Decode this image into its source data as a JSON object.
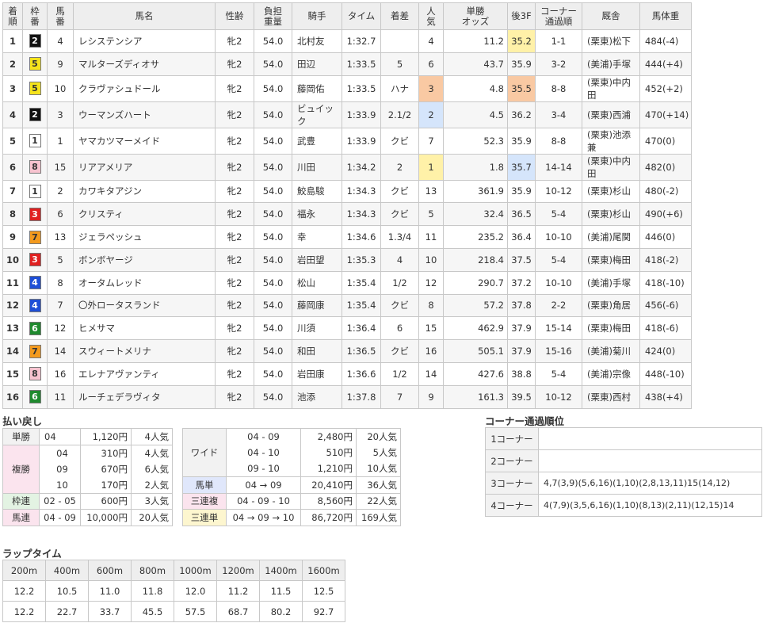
{
  "results": {
    "headers": [
      "着\n順",
      "枠\n番",
      "馬\n番",
      "馬名",
      "性齢",
      "負担\n重量",
      "騎手",
      "タイム",
      "着差",
      "人\n気",
      "単勝\nオッズ",
      "後3F",
      "コーナー\n通過順",
      "厩舎",
      "馬体重"
    ],
    "rows": [
      {
        "rank": "1",
        "waku": "2",
        "umaban": "4",
        "name": "レシステンシア",
        "sex_age": "牝2",
        "weight": "54.0",
        "jockey": "北村友",
        "time": "1:32.7",
        "margin": "",
        "pop": "4",
        "odds": "11.2",
        "last3f": "35.2",
        "corner": "1-1",
        "stable": "(栗東)松下",
        "bw": "484(-4)"
      },
      {
        "rank": "2",
        "waku": "5",
        "umaban": "9",
        "name": "マルターズディオサ",
        "sex_age": "牝2",
        "weight": "54.0",
        "jockey": "田辺",
        "time": "1:33.5",
        "margin": "5",
        "pop": "6",
        "odds": "43.7",
        "last3f": "35.9",
        "corner": "3-2",
        "stable": "(美浦)手塚",
        "bw": "444(+4)"
      },
      {
        "rank": "3",
        "waku": "5",
        "umaban": "10",
        "name": "クラヴァシュドール",
        "sex_age": "牝2",
        "weight": "54.0",
        "jockey": "藤岡佑",
        "time": "1:33.5",
        "margin": "ハナ",
        "pop": "3",
        "odds": "4.8",
        "last3f": "35.5",
        "corner": "8-8",
        "stable": "(栗東)中内田",
        "bw": "452(+2)"
      },
      {
        "rank": "4",
        "waku": "2",
        "umaban": "3",
        "name": "ウーマンズハート",
        "sex_age": "牝2",
        "weight": "54.0",
        "jockey": "ビュイック",
        "time": "1:33.9",
        "margin": "2.1/2",
        "pop": "2",
        "odds": "4.5",
        "last3f": "36.2",
        "corner": "3-4",
        "stable": "(栗東)西浦",
        "bw": "470(+14)"
      },
      {
        "rank": "5",
        "waku": "1",
        "umaban": "1",
        "name": "ヤマカツマーメイド",
        "sex_age": "牝2",
        "weight": "54.0",
        "jockey": "武豊",
        "time": "1:33.9",
        "margin": "クビ",
        "pop": "7",
        "odds": "52.3",
        "last3f": "35.9",
        "corner": "8-8",
        "stable": "(栗東)池添兼",
        "bw": "470(0)"
      },
      {
        "rank": "6",
        "waku": "8",
        "umaban": "15",
        "name": "リアアメリア",
        "sex_age": "牝2",
        "weight": "54.0",
        "jockey": "川田",
        "time": "1:34.2",
        "margin": "2",
        "pop": "1",
        "odds": "1.8",
        "last3f": "35.7",
        "corner": "14-14",
        "stable": "(栗東)中内田",
        "bw": "482(0)"
      },
      {
        "rank": "7",
        "waku": "1",
        "umaban": "2",
        "name": "カワキタアジン",
        "sex_age": "牝2",
        "weight": "54.0",
        "jockey": "鮫島駿",
        "time": "1:34.3",
        "margin": "クビ",
        "pop": "13",
        "odds": "361.9",
        "last3f": "35.9",
        "corner": "10-12",
        "stable": "(栗東)杉山",
        "bw": "480(-2)"
      },
      {
        "rank": "8",
        "waku": "3",
        "umaban": "6",
        "name": "クリスティ",
        "sex_age": "牝2",
        "weight": "54.0",
        "jockey": "福永",
        "time": "1:34.3",
        "margin": "クビ",
        "pop": "5",
        "odds": "32.4",
        "last3f": "36.5",
        "corner": "5-4",
        "stable": "(栗東)杉山",
        "bw": "490(+6)"
      },
      {
        "rank": "9",
        "waku": "7",
        "umaban": "13",
        "name": "ジェラペッシュ",
        "sex_age": "牝2",
        "weight": "54.0",
        "jockey": "幸",
        "time": "1:34.6",
        "margin": "1.3/4",
        "pop": "11",
        "odds": "235.2",
        "last3f": "36.4",
        "corner": "10-10",
        "stable": "(美浦)尾関",
        "bw": "446(0)"
      },
      {
        "rank": "10",
        "waku": "3",
        "umaban": "5",
        "name": "ボンボヤージ",
        "sex_age": "牝2",
        "weight": "54.0",
        "jockey": "岩田望",
        "time": "1:35.3",
        "margin": "4",
        "pop": "10",
        "odds": "218.4",
        "last3f": "37.5",
        "corner": "5-4",
        "stable": "(栗東)梅田",
        "bw": "418(-2)"
      },
      {
        "rank": "11",
        "waku": "4",
        "umaban": "8",
        "name": "オータムレッド",
        "sex_age": "牝2",
        "weight": "54.0",
        "jockey": "松山",
        "time": "1:35.4",
        "margin": "1/2",
        "pop": "12",
        "odds": "290.7",
        "last3f": "37.2",
        "corner": "10-10",
        "stable": "(美浦)手塚",
        "bw": "418(-10)"
      },
      {
        "rank": "12",
        "waku": "4",
        "umaban": "7",
        "name": "〇外ロータスランド",
        "sex_age": "牝2",
        "weight": "54.0",
        "jockey": "藤岡康",
        "time": "1:35.4",
        "margin": "クビ",
        "pop": "8",
        "odds": "57.2",
        "last3f": "37.8",
        "corner": "2-2",
        "stable": "(栗東)角居",
        "bw": "456(-6)"
      },
      {
        "rank": "13",
        "waku": "6",
        "umaban": "12",
        "name": "ヒメサマ",
        "sex_age": "牝2",
        "weight": "54.0",
        "jockey": "川須",
        "time": "1:36.4",
        "margin": "6",
        "pop": "15",
        "odds": "462.9",
        "last3f": "37.9",
        "corner": "15-14",
        "stable": "(栗東)梅田",
        "bw": "418(-6)"
      },
      {
        "rank": "14",
        "waku": "7",
        "umaban": "14",
        "name": "スウィートメリナ",
        "sex_age": "牝2",
        "weight": "54.0",
        "jockey": "和田",
        "time": "1:36.5",
        "margin": "クビ",
        "pop": "16",
        "odds": "505.1",
        "last3f": "37.9",
        "corner": "15-16",
        "stable": "(美浦)菊川",
        "bw": "424(0)"
      },
      {
        "rank": "15",
        "waku": "8",
        "umaban": "16",
        "name": "エレナアヴァンティ",
        "sex_age": "牝2",
        "weight": "54.0",
        "jockey": "岩田康",
        "time": "1:36.6",
        "margin": "1/2",
        "pop": "14",
        "odds": "427.6",
        "last3f": "38.8",
        "corner": "5-4",
        "stable": "(美浦)宗像",
        "bw": "448(-10)"
      },
      {
        "rank": "16",
        "waku": "6",
        "umaban": "11",
        "name": "ルーチェデラヴィタ",
        "sex_age": "牝2",
        "weight": "54.0",
        "jockey": "池添",
        "time": "1:37.8",
        "margin": "7",
        "pop": "9",
        "odds": "161.3",
        "last3f": "39.5",
        "corner": "10-12",
        "stable": "(栗東)西村",
        "bw": "438(+4)"
      }
    ],
    "waku_colors": {
      "1": {
        "bg": "#ffffff",
        "fg": "#333333"
      },
      "2": {
        "bg": "#111111",
        "fg": "#ffffff"
      },
      "3": {
        "bg": "#e02020",
        "fg": "#ffffff"
      },
      "4": {
        "bg": "#1e4fd6",
        "fg": "#ffffff"
      },
      "5": {
        "bg": "#f5e31c",
        "fg": "#333333"
      },
      "6": {
        "bg": "#1f8a2e",
        "fg": "#ffffff"
      },
      "7": {
        "bg": "#f39a1e",
        "fg": "#333333"
      },
      "8": {
        "bg": "#f7c3cf",
        "fg": "#333333"
      }
    },
    "pop_highlights": {
      "1": "#fff1a8",
      "2": "#d5e5fb",
      "3": "#f9c9a3"
    },
    "last3f_highlights": {
      "1": "#fff1a8",
      "2": "#f9c9a3",
      "3": "#d5e5fb"
    }
  },
  "payout": {
    "title": "払い戻し",
    "tansho": {
      "label": "単勝",
      "combos": [
        "04"
      ],
      "yen": [
        "1,120円"
      ],
      "pop": [
        "4人気"
      ]
    },
    "fukusho": {
      "label": "複勝",
      "combos": [
        "04",
        "09",
        "10"
      ],
      "yen": [
        "310円",
        "670円",
        "170円"
      ],
      "pop": [
        "4人気",
        "6人気",
        "2人気"
      ]
    },
    "wakuren": {
      "label": "枠連",
      "combos": [
        "02 - 05"
      ],
      "yen": [
        "600円"
      ],
      "pop": [
        "3人気"
      ]
    },
    "umaren": {
      "label": "馬連",
      "combos": [
        "04 - 09"
      ],
      "yen": [
        "10,000円"
      ],
      "pop": [
        "20人気"
      ]
    },
    "wide": {
      "label": "ワイド",
      "combos": [
        "04 - 09",
        "04 - 10",
        "09 - 10"
      ],
      "yen": [
        "2,480円",
        "510円",
        "1,210円"
      ],
      "pop": [
        "20人気",
        "5人気",
        "10人気"
      ]
    },
    "umatan": {
      "label": "馬単",
      "combos": [
        "04 → 09"
      ],
      "yen": [
        "20,410円"
      ],
      "pop": [
        "36人気"
      ]
    },
    "sanrenpuku": {
      "label": "三連複",
      "combos": [
        "04 - 09 - 10"
      ],
      "yen": [
        "8,560円"
      ],
      "pop": [
        "22人気"
      ]
    },
    "sanrentan": {
      "label": "三連単",
      "combos": [
        "04 → 09 → 10"
      ],
      "yen": [
        "86,720円"
      ],
      "pop": [
        "169人気"
      ]
    }
  },
  "corner": {
    "title": "コーナー通過順位",
    "rows": [
      {
        "label": "1コーナー",
        "value": ""
      },
      {
        "label": "2コーナー",
        "value": ""
      },
      {
        "label": "3コーナー",
        "value": "4,7(3,9)(5,6,16)(1,10)(2,8,13,11)15(14,12)"
      },
      {
        "label": "4コーナー",
        "value": "4(7,9)(3,5,6,16)(1,10)(8,13)(2,11)(12,15)14"
      }
    ]
  },
  "lap": {
    "title": "ラップタイム",
    "headers": [
      "200m",
      "400m",
      "600m",
      "800m",
      "1000m",
      "1200m",
      "1400m",
      "1600m"
    ],
    "laps": [
      "12.2",
      "10.5",
      "11.0",
      "11.8",
      "12.0",
      "11.2",
      "11.5",
      "12.5"
    ],
    "cumulative": [
      "12.2",
      "22.7",
      "33.7",
      "45.5",
      "57.5",
      "68.7",
      "80.2",
      "92.7"
    ]
  }
}
